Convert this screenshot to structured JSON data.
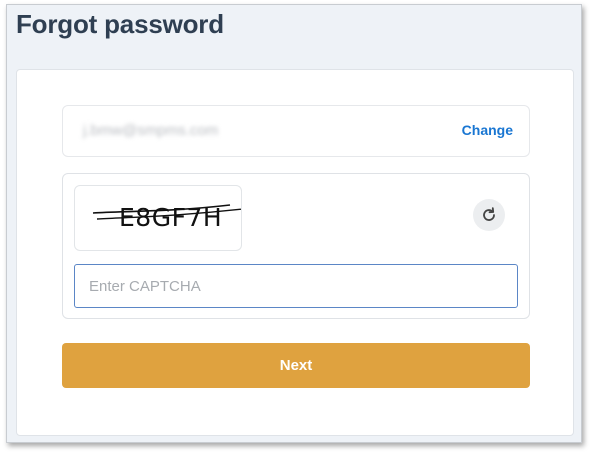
{
  "page": {
    "title": "Forgot password"
  },
  "email_row": {
    "value": "j.bmw@smpms.com",
    "change_label": "Change"
  },
  "captcha": {
    "code": "E8GF7H",
    "input_placeholder": "Enter CAPTCHA",
    "input_value": "",
    "refresh_icon": "refresh-icon"
  },
  "actions": {
    "next_label": "Next"
  },
  "colors": {
    "title": "#2f3f52",
    "link": "#1976d2",
    "primary_button": "#dfa23f",
    "input_focus_border": "#5b86c6",
    "page_background": "#eef2f7"
  }
}
